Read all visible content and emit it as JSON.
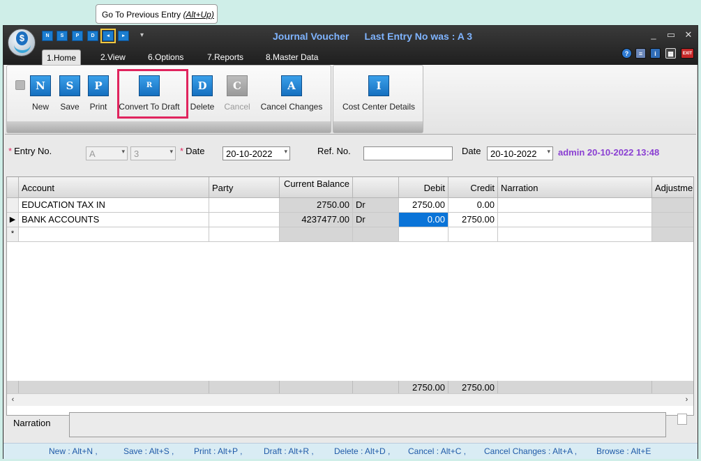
{
  "tooltip": {
    "text": "Go To Previous Entry ",
    "shortcut": "(Alt+Up)"
  },
  "window": {
    "title": "Journal Voucher",
    "last_entry": "Last Entry No was : A 3",
    "min": "_",
    "max": "▭",
    "close": "✕"
  },
  "quick_access": [
    {
      "name": "new",
      "label": "N"
    },
    {
      "name": "save",
      "label": "S"
    },
    {
      "name": "print",
      "label": "P"
    },
    {
      "name": "delete",
      "label": "D"
    },
    {
      "name": "previous",
      "label": "◂"
    },
    {
      "name": "next",
      "label": "▸"
    }
  ],
  "tabs": [
    "1.Home",
    "2.View",
    "6.Options",
    "7.Reports",
    "8.Master Data"
  ],
  "top_icons": {
    "help": "?",
    "info": "i",
    "exit": "EXIT"
  },
  "ribbon": {
    "new": "New",
    "save": "Save",
    "print": "Print",
    "convert": "Convert To Draft",
    "delete": "Delete",
    "cancel": "Cancel",
    "cancel_changes": "Cancel Changes",
    "cost_center": "Cost Center Details",
    "icons": {
      "new": "N",
      "save": "S",
      "print": "P",
      "convert": "R",
      "delete": "D",
      "cancel": "C",
      "cancel_changes": "A",
      "cost_center": "I"
    }
  },
  "form": {
    "entry_no_label": "Entry No.",
    "series": "A",
    "entry_no": "3",
    "date_label": "Date",
    "date": "20-10-2022",
    "ref_label": "Ref. No.",
    "ref_value": "",
    "date2_label": "Date",
    "date2": "20-10-2022",
    "audit": "admin 20-10-2022 13:48"
  },
  "grid": {
    "headers": {
      "account": "Account",
      "party": "Party",
      "balance": "Current Balance",
      "drcr": "",
      "debit": "Debit",
      "credit": "Credit",
      "narration": "Narration",
      "adjustment": "Adjustme"
    },
    "rows": [
      {
        "account": "EDUCATION TAX IN",
        "party": "",
        "balance": "2750.00",
        "drcr": "Dr",
        "debit": "2750.00",
        "credit": "0.00",
        "narration": ""
      },
      {
        "account": "BANK ACCOUNTS",
        "party": "",
        "balance": "4237477.00",
        "drcr": "Dr",
        "debit": "0.00",
        "credit": "2750.00",
        "narration": ""
      }
    ],
    "new_row_marker": "*",
    "current_row_marker": "▶",
    "totals": {
      "debit": "2750.00",
      "credit": "2750.00"
    }
  },
  "narration_label": "Narration",
  "shortcuts": [
    "New : Alt+N ,",
    "Save : Alt+S ,",
    "Print : Alt+P ,",
    "Draft : Alt+R ,",
    "Delete : Alt+D ,",
    "Cancel : Alt+C ,",
    "Cancel Changes : Alt+A ,",
    "Browse : Alt+E"
  ]
}
